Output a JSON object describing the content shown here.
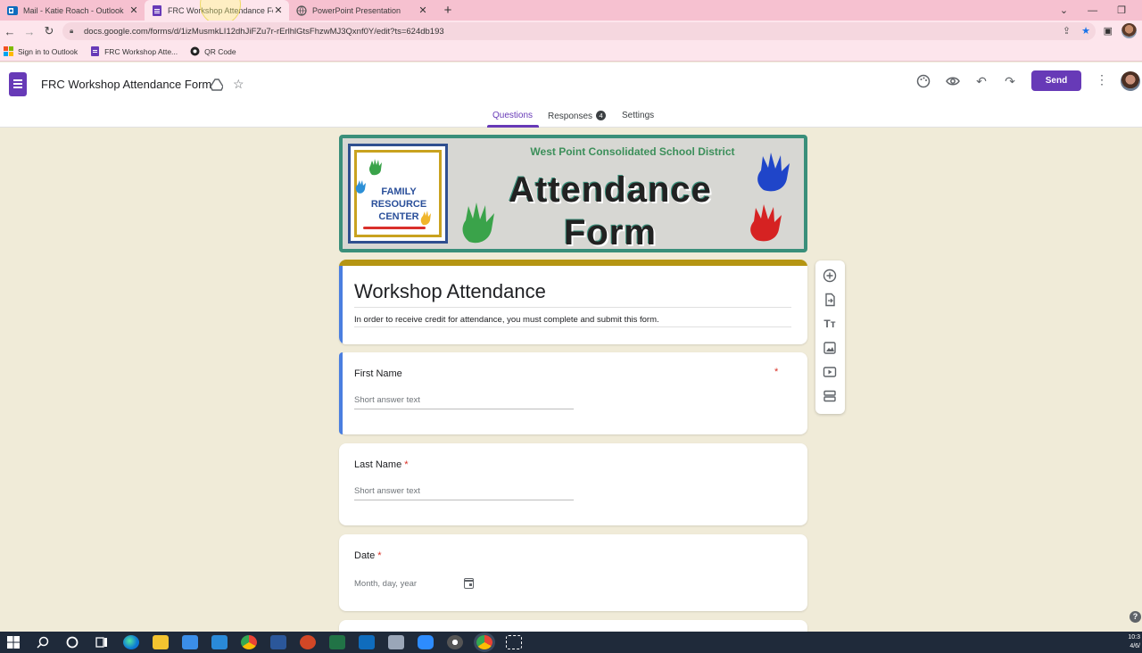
{
  "browser": {
    "tabs": [
      {
        "title": "Mail - Katie Roach - Outlook",
        "icon": "outlook-icon",
        "active": false
      },
      {
        "title": "FRC Workshop Attendance Form",
        "icon": "forms-icon",
        "active": true
      },
      {
        "title": "PowerPoint Presentation",
        "icon": "globe-icon",
        "active": false
      }
    ],
    "url": "docs.google.com/forms/d/1izMusmkLI12dhJiFZu7r-rErlhlGtsFhzwMJ3Qxnf0Y/edit?ts=624db193",
    "bookmarks": [
      {
        "label": "Sign in to Outlook",
        "icon": "microsoft-icon"
      },
      {
        "label": "FRC Workshop Atte...",
        "icon": "forms-icon"
      },
      {
        "label": "QR Code",
        "icon": "qr-icon"
      }
    ]
  },
  "header": {
    "doc_title": "FRC Workshop Attendance Form",
    "send_label": "Send",
    "tabs": {
      "questions": "Questions",
      "responses": "Responses",
      "responses_count": "4",
      "settings": "Settings"
    }
  },
  "banner": {
    "district": "West Point Consolidated School District",
    "title_line1": "Attendance",
    "title_line2": "Form",
    "logo_line1": "FAMILY",
    "logo_line2": "RESOURCE",
    "logo_line3": "CENTER"
  },
  "form": {
    "title": "Workshop Attendance",
    "description": "In order to receive credit for attendance, you must complete and submit this form.",
    "questions": [
      {
        "label": "First Name",
        "required": true,
        "placeholder": "Short answer text"
      },
      {
        "label": "Last Name",
        "required": true,
        "placeholder": "Short answer text"
      },
      {
        "label": "Date",
        "required": true,
        "placeholder": "Month, day, year"
      }
    ],
    "required_mark": "*"
  },
  "colors": {
    "accent": "#673ab7",
    "theme_bg": "#f0ebd8",
    "title_bar": "#b59512",
    "focus_bar": "#4a7ee0"
  },
  "taskbar": {
    "time": "10:3",
    "date": "4/6/"
  }
}
